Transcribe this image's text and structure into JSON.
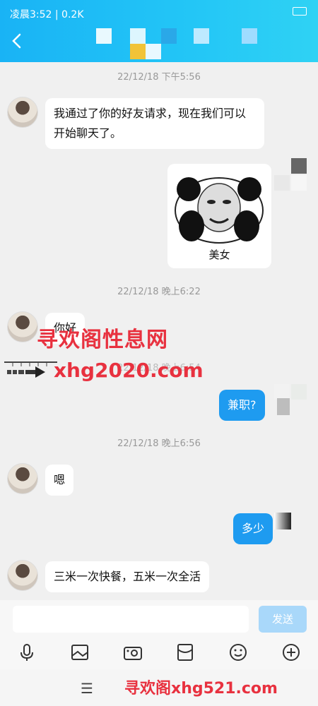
{
  "status_bar": {
    "time": "凌晨3:52 | 0.2K"
  },
  "messages": [
    {
      "type": "timestamp",
      "text": "22/12/18 下午5:56"
    },
    {
      "type": "incoming",
      "text": "我通过了你的好友请求，现在我们可以开始聊天了。"
    },
    {
      "type": "outgoing-sticker",
      "caption": "美女"
    },
    {
      "type": "timestamp",
      "text": "22/12/18 晚上6:22"
    },
    {
      "type": "incoming",
      "text": "你好"
    },
    {
      "type": "timestamp",
      "text": "22/12/18 晚上6:54"
    },
    {
      "type": "outgoing",
      "text": "兼职?"
    },
    {
      "type": "timestamp",
      "text": "22/12/18 晚上6:56"
    },
    {
      "type": "incoming",
      "text": "嗯"
    },
    {
      "type": "outgoing",
      "text": "多少"
    },
    {
      "type": "incoming",
      "text": "三米一次快餐，五米一次全活"
    }
  ],
  "input": {
    "send_label": "发送"
  },
  "toolbar": {
    "icons": [
      "microphone-icon",
      "image-icon",
      "camera-icon",
      "red-packet-icon",
      "emoji-icon",
      "plus-icon"
    ]
  },
  "watermarks": {
    "line1": "寻欢阁性息网",
    "line2": "xhg2020.com",
    "bottom": "寻欢阁xhg521.com"
  },
  "colors": {
    "topbar": "#19b3f5",
    "bubble_out": "#1e9bf0",
    "watermark": "#e8313f"
  }
}
